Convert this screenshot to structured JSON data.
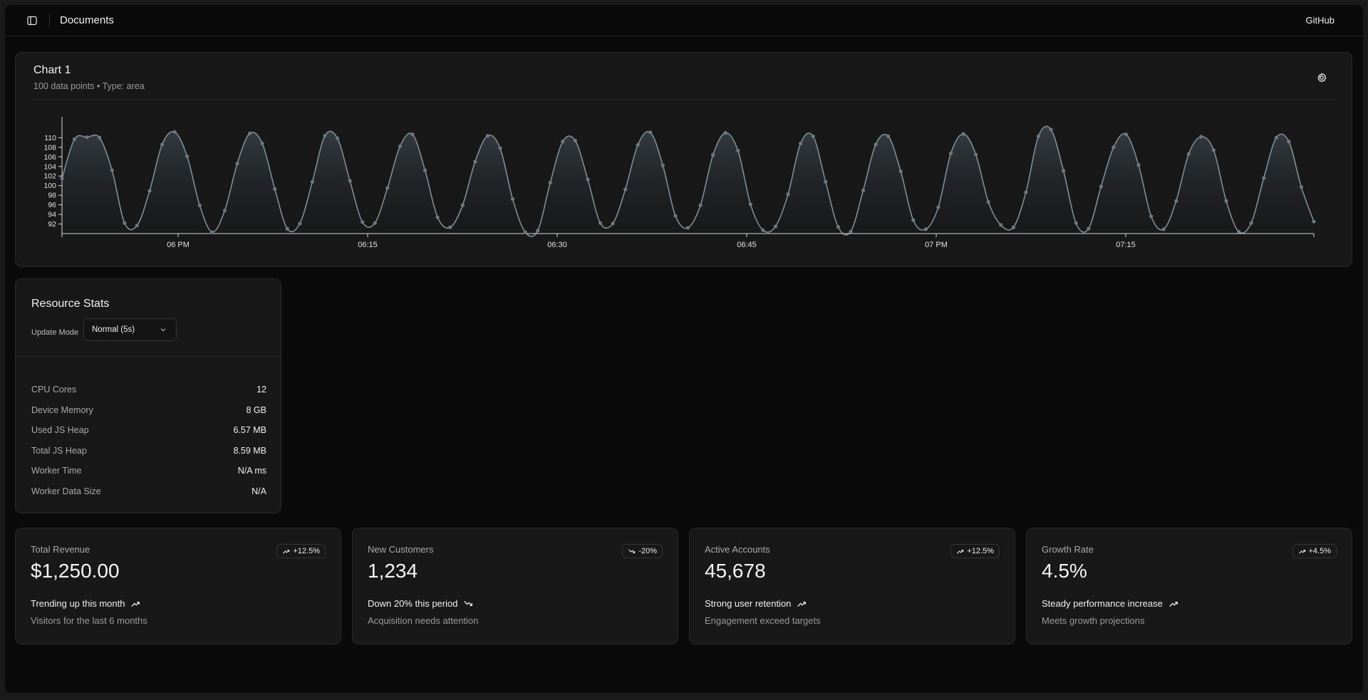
{
  "header": {
    "title": "Documents",
    "github_label": "GitHub"
  },
  "chart": {
    "title": "Chart 1",
    "subtitle": "100 data points • Type: area",
    "colors": {
      "line": "#7f8d96",
      "point": "#6d7880",
      "axis": "#d8d8d8"
    }
  },
  "chart_data": {
    "type": "area",
    "x_tick_labels": [
      "06 PM",
      "06:15",
      "06:30",
      "06:45",
      "07 PM",
      "07:15"
    ],
    "y_tick_labels": [
      "92",
      "94",
      "96",
      "98",
      "100",
      "102",
      "104",
      "106",
      "108",
      "110"
    ],
    "ylim": [
      90,
      112
    ],
    "grid": false,
    "points_count": 100,
    "peaks": [
      110.0,
      111.2,
      110.8,
      110.5,
      110.7,
      110.4,
      110.5,
      111.1,
      111.0,
      110.5,
      110.3,
      110.8,
      111.8,
      110.3,
      110.2,
      110.3
    ],
    "troughs": [
      91.2,
      90.3,
      91.0,
      91.0,
      90.8,
      90.1,
      90.8,
      91.1,
      90.7,
      90.3,
      90.8,
      91.2,
      90.5,
      91.0,
      91.1,
      90.6
    ],
    "values": [
      101.5,
      109.7,
      110.1,
      110.0,
      103.2,
      92.2,
      91.7,
      98.9,
      108.6,
      111.2,
      106.1,
      95.9,
      90.3,
      94.8,
      104.6,
      110.9,
      108.8,
      99.3,
      91.0,
      92.1,
      100.8,
      110.4,
      109.9,
      101.0,
      92.4,
      92.2,
      99.5,
      108.2,
      110.7,
      103.2,
      93.4,
      91.3,
      95.9,
      105.0,
      110.4,
      107.8,
      97.2,
      90.3,
      90.6,
      100.6,
      109.2,
      109.4,
      101.3,
      92.2,
      92.1,
      99.2,
      108.5,
      111.1,
      104.2,
      93.7,
      91.2,
      95.9,
      106.4,
      111.0,
      107.3,
      96.1,
      90.7,
      91.5,
      98.2,
      108.8,
      110.3,
      100.8,
      91.4,
      90.4,
      99.0,
      108.6,
      110.3,
      103.0,
      92.8,
      90.9,
      95.5,
      106.7,
      110.8,
      106.5,
      96.6,
      91.8,
      91.3,
      98.6,
      110.3,
      111.7,
      103.1,
      92.2,
      91.0,
      99.8,
      108.0,
      110.7,
      104.3,
      93.6,
      90.9,
      96.8,
      106.6,
      110.2,
      107.4,
      96.8,
      90.4,
      92.2,
      101.6,
      110.0,
      109.2,
      99.7,
      92.5
    ]
  },
  "stats": {
    "title": "Resource Stats",
    "update_mode_label": "Update Mode",
    "update_mode_value": "Normal (5s)",
    "rows": [
      {
        "label": "CPU Cores",
        "value": "12"
      },
      {
        "label": "Device Memory",
        "value": "8 GB"
      },
      {
        "label": "Used JS Heap",
        "value": "6.57 MB"
      },
      {
        "label": "Total JS Heap",
        "value": "8.59 MB"
      },
      {
        "label": "Worker Time",
        "value": "N/A ms"
      },
      {
        "label": "Worker Data Size",
        "value": "N/A"
      }
    ]
  },
  "metrics": [
    {
      "label": "Total Revenue",
      "value": "$1,250.00",
      "badge": "+12.5%",
      "direction": "up",
      "trend": "Trending up this month",
      "note": "Visitors for the last 6 months"
    },
    {
      "label": "New Customers",
      "value": "1,234",
      "badge": "-20%",
      "direction": "down",
      "trend": "Down 20% this period",
      "note": "Acquisition needs attention"
    },
    {
      "label": "Active Accounts",
      "value": "45,678",
      "badge": "+12.5%",
      "direction": "up",
      "trend": "Strong user retention",
      "note": "Engagement exceed targets"
    },
    {
      "label": "Growth Rate",
      "value": "4.5%",
      "badge": "+4.5%",
      "direction": "up",
      "trend": "Steady performance increase",
      "note": "Meets growth projections"
    }
  ]
}
